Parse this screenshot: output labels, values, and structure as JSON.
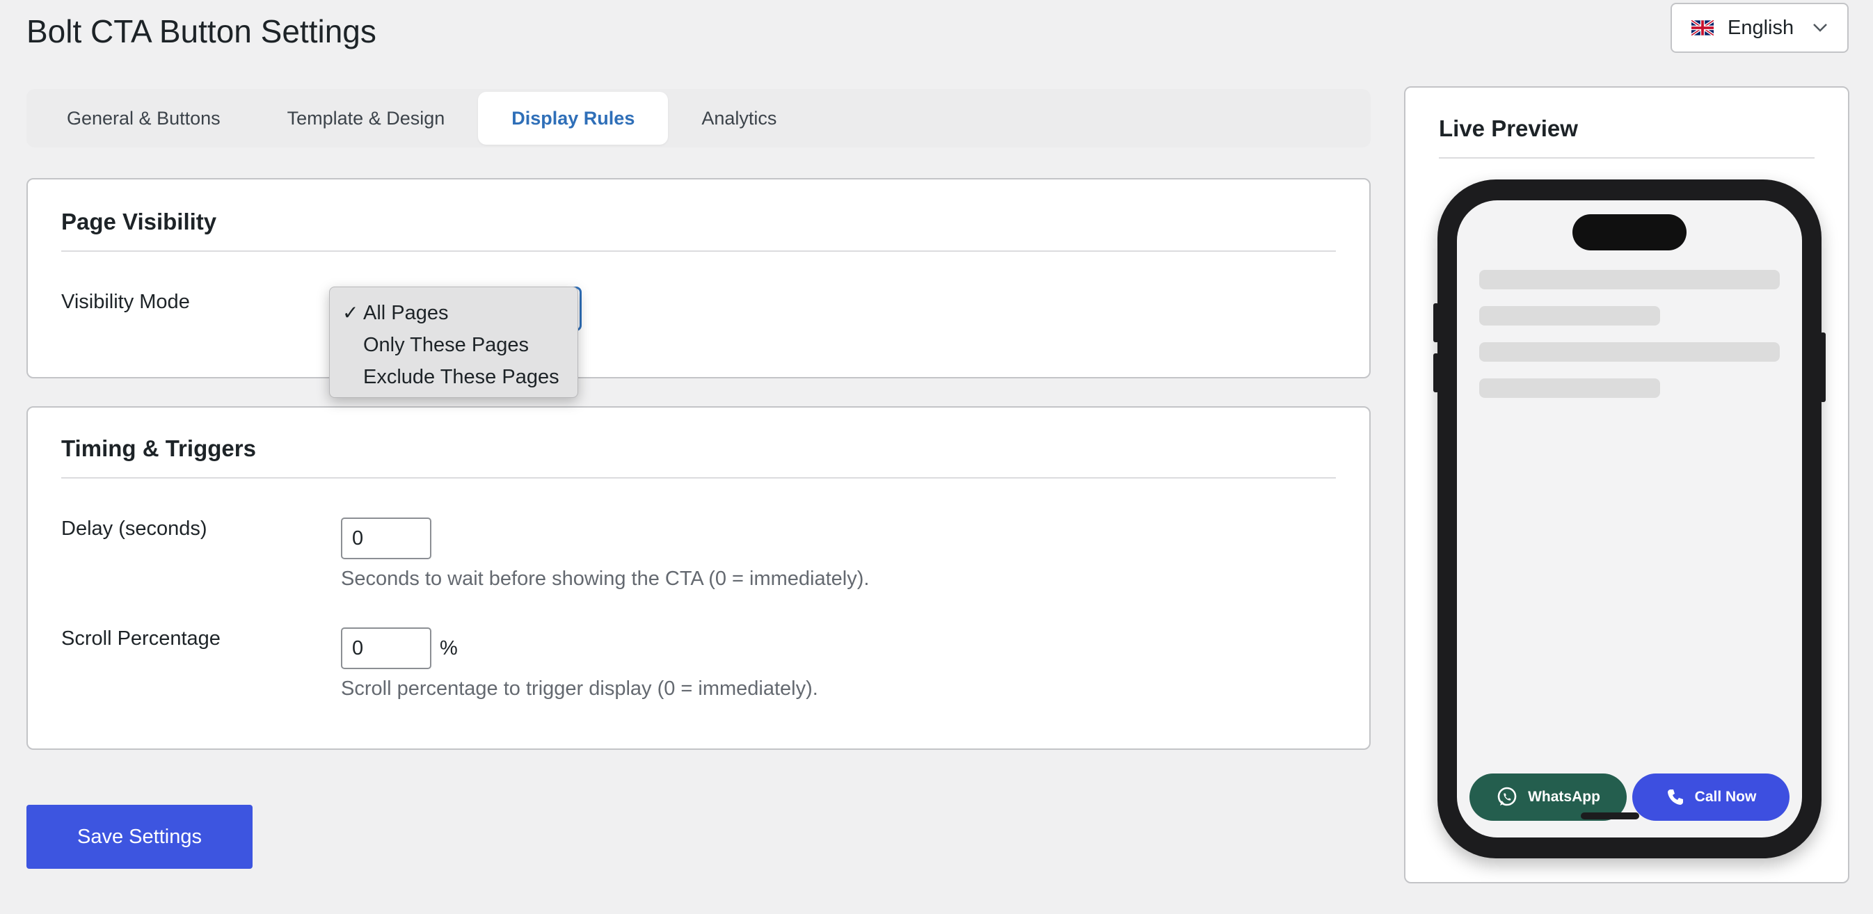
{
  "header": {
    "title": "Bolt CTA Button Settings"
  },
  "language": {
    "label": "English",
    "flag_icon": "uk-flag-icon"
  },
  "tabs": [
    {
      "label": "General & Buttons",
      "active": false
    },
    {
      "label": "Template & Design",
      "active": false
    },
    {
      "label": "Display Rules",
      "active": true
    },
    {
      "label": "Analytics",
      "active": false
    }
  ],
  "page_visibility": {
    "title": "Page Visibility",
    "visibility_mode_label": "Visibility Mode",
    "options": [
      "All Pages",
      "Only These Pages",
      "Exclude These Pages"
    ],
    "selected": "All Pages",
    "checkmark": "✓"
  },
  "timing": {
    "title": "Timing & Triggers",
    "delay_label": "Delay (seconds)",
    "delay_value": "0",
    "delay_help": "Seconds to wait before showing the CTA (0 = immediately).",
    "scroll_label": "Scroll Percentage",
    "scroll_value": "0",
    "scroll_unit": "%",
    "scroll_help": "Scroll percentage to trigger display (0 = immediately)."
  },
  "actions": {
    "save_label": "Save Settings"
  },
  "preview": {
    "title": "Live Preview",
    "whatsapp_label": "WhatsApp",
    "call_label": "Call Now"
  },
  "colors": {
    "accent": "#3d55e0",
    "active_tab": "#2f6fb8",
    "whatsapp": "#245e4e",
    "call": "#3d4fe0"
  }
}
